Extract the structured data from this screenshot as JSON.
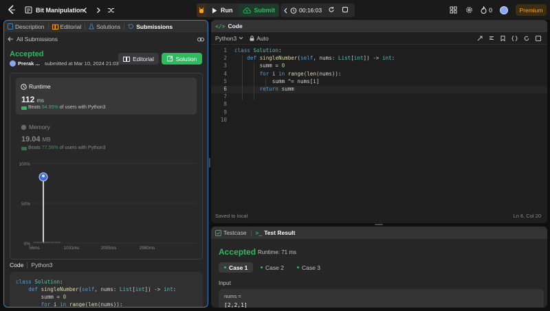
{
  "topbar": {
    "problem_list_title": "Bit Manipulation",
    "run_label": "Run",
    "submit_label": "Submit",
    "timer": "00:16:03",
    "streak_count": "0",
    "premium_label": "Premium"
  },
  "left_tabs": {
    "description": "Description",
    "editorial": "Editorial",
    "solutions": "Solutions",
    "submissions": "Submissions"
  },
  "submission": {
    "back_label": "All Submissions",
    "status": "Accepted",
    "author": "Prerak ...",
    "submitted_at": "submitted at Mar 10, 2024 21:03",
    "editorial_button": "Editorial",
    "solution_button": "Solution",
    "runtime": {
      "label": "Runtime",
      "value": "112",
      "unit": "ms",
      "beats_prefix": "Beats",
      "beats_pct": "54.95%",
      "beats_suffix": "of users with Python3"
    },
    "memory": {
      "label": "Memory",
      "value": "19.04",
      "unit": "MB",
      "beats_prefix": "Beats",
      "beats_pct": "77.56%",
      "beats_suffix": "of users with Python3"
    },
    "code_label": "Code",
    "code_lang": "Python3",
    "code_lines": [
      "class Solution:",
      "    def singleNumber(self, nums: List[int]) -> int:",
      "        summ = 0",
      "        for i in range(len(nums)):"
    ]
  },
  "chart_data": {
    "type": "bar",
    "ytick_labels": [
      "100%",
      "50%",
      "0%"
    ],
    "xtick_labels": [
      "56ms",
      "1031ms",
      "2005ms",
      "2980ms"
    ],
    "minimap_tick_labels": [
      "56ms",
      "1031ms",
      "2005ms",
      "2980ms"
    ],
    "highlight_bar": {
      "x": "112 ms",
      "y_pct": 83
    },
    "ylim": [
      0,
      100
    ]
  },
  "code_panel": {
    "title": "Code",
    "language": "Python3",
    "autosave": "Auto",
    "saved_status": "Saved to local",
    "cursor": "Ln 6, Col 20",
    "line_numbers": [
      "1",
      "2",
      "3",
      "4",
      "5",
      "6",
      "7",
      "8",
      "9",
      "10"
    ]
  },
  "result_panel": {
    "testcase_tab": "Testcase",
    "result_tab": "Test Result",
    "status": "Accepted",
    "runtime": "Runtime: 71 ms",
    "cases": [
      "Case 1",
      "Case 2",
      "Case 3"
    ],
    "input_label": "Input",
    "input_var": "nums =",
    "input_value": "[2,2,1]"
  },
  "colors": {
    "accent_green": "#2cbb5d",
    "accent_blue": "#3b82c6",
    "premium_orange": "#ffa116"
  }
}
